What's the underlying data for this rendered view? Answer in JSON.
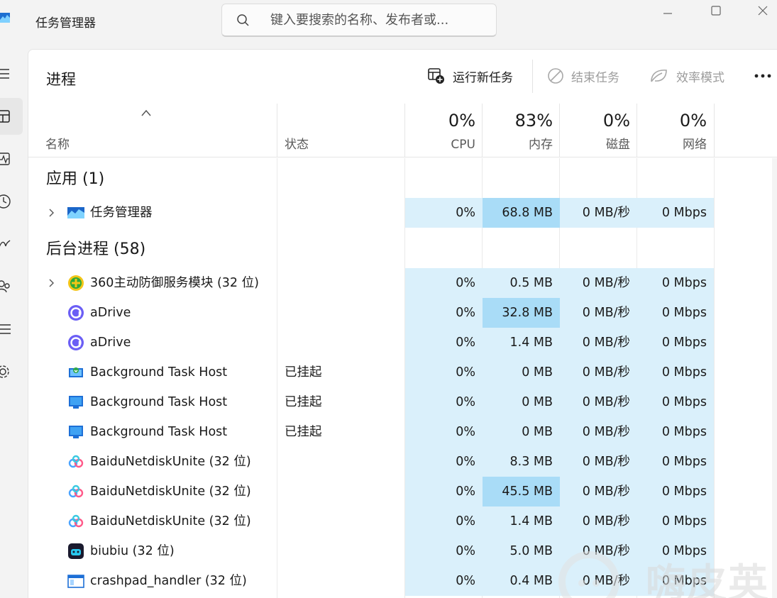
{
  "window": {
    "title": "任务管理器",
    "search_placeholder": "键入要搜索的名称、发布者或..."
  },
  "toolbar": {
    "page_title": "进程",
    "run_new_task": "运行新任务",
    "end_task": "结束任务",
    "efficiency_mode": "效率模式",
    "more": "•••"
  },
  "columns": {
    "name": "名称",
    "status": "状态",
    "cpu": {
      "label": "CPU",
      "pct": "0%"
    },
    "memory": {
      "label": "内存",
      "pct": "83%"
    },
    "disk": {
      "label": "磁盘",
      "pct": "0%"
    },
    "network": {
      "label": "网络",
      "pct": "0%"
    }
  },
  "groups": {
    "apps": "应用 (1)",
    "background": "后台进程 (58)"
  },
  "processes": [
    {
      "name": "任务管理器",
      "status": "",
      "cpu": "0%",
      "memory": "68.8 MB",
      "disk": "0 MB/秒",
      "network": "0 Mbps",
      "icon": "task-manager-icon",
      "expandable": true,
      "memory_hot": true
    },
    {
      "name": "360主动防御服务模块 (32 位)",
      "status": "",
      "cpu": "0%",
      "memory": "0.5 MB",
      "disk": "0 MB/秒",
      "network": "0 Mbps",
      "icon": "360-shield-icon",
      "expandable": true,
      "memory_hot": false
    },
    {
      "name": "aDrive",
      "status": "",
      "cpu": "0%",
      "memory": "32.8 MB",
      "disk": "0 MB/秒",
      "network": "0 Mbps",
      "icon": "adrive-icon",
      "expandable": false,
      "memory_hot": true
    },
    {
      "name": "aDrive",
      "status": "",
      "cpu": "0%",
      "memory": "1.4 MB",
      "disk": "0 MB/秒",
      "network": "0 Mbps",
      "icon": "adrive-icon",
      "expandable": false,
      "memory_hot": false
    },
    {
      "name": "Background Task Host",
      "status": "已挂起",
      "cpu": "0%",
      "memory": "0 MB",
      "disk": "0 MB/秒",
      "network": "0 Mbps",
      "icon": "background-task-green-icon",
      "expandable": false,
      "memory_hot": false
    },
    {
      "name": "Background Task Host",
      "status": "已挂起",
      "cpu": "0%",
      "memory": "0 MB",
      "disk": "0 MB/秒",
      "network": "0 Mbps",
      "icon": "background-task-icon",
      "expandable": false,
      "memory_hot": false
    },
    {
      "name": "Background Task Host",
      "status": "已挂起",
      "cpu": "0%",
      "memory": "0 MB",
      "disk": "0 MB/秒",
      "network": "0 Mbps",
      "icon": "background-task-icon",
      "expandable": false,
      "memory_hot": false
    },
    {
      "name": "BaiduNetdiskUnite (32 位)",
      "status": "",
      "cpu": "0%",
      "memory": "8.3 MB",
      "disk": "0 MB/秒",
      "network": "0 Mbps",
      "icon": "baidu-netdisk-icon",
      "expandable": false,
      "memory_hot": false
    },
    {
      "name": "BaiduNetdiskUnite (32 位)",
      "status": "",
      "cpu": "0%",
      "memory": "45.5 MB",
      "disk": "0 MB/秒",
      "network": "0 Mbps",
      "icon": "baidu-netdisk-icon",
      "expandable": false,
      "memory_hot": true
    },
    {
      "name": "BaiduNetdiskUnite (32 位)",
      "status": "",
      "cpu": "0%",
      "memory": "1.4 MB",
      "disk": "0 MB/秒",
      "network": "0 Mbps",
      "icon": "baidu-netdisk-icon",
      "expandable": false,
      "memory_hot": false
    },
    {
      "name": "biubiu (32 位)",
      "status": "",
      "cpu": "0%",
      "memory": "5.0 MB",
      "disk": "0 MB/秒",
      "network": "0 Mbps",
      "icon": "biubiu-icon",
      "expandable": false,
      "memory_hot": false
    },
    {
      "name": "crashpad_handler (32 位)",
      "status": "",
      "cpu": "0%",
      "memory": "0.4 MB",
      "disk": "0 MB/秒",
      "network": "0 Mbps",
      "icon": "crashpad-window-icon",
      "expandable": false,
      "memory_hot": false
    }
  ],
  "watermark": "嗨皮英",
  "colors": {
    "heat_light": "#daf0fb",
    "heat_strong": "#a9dcf7",
    "accent": "#0a64c8"
  }
}
